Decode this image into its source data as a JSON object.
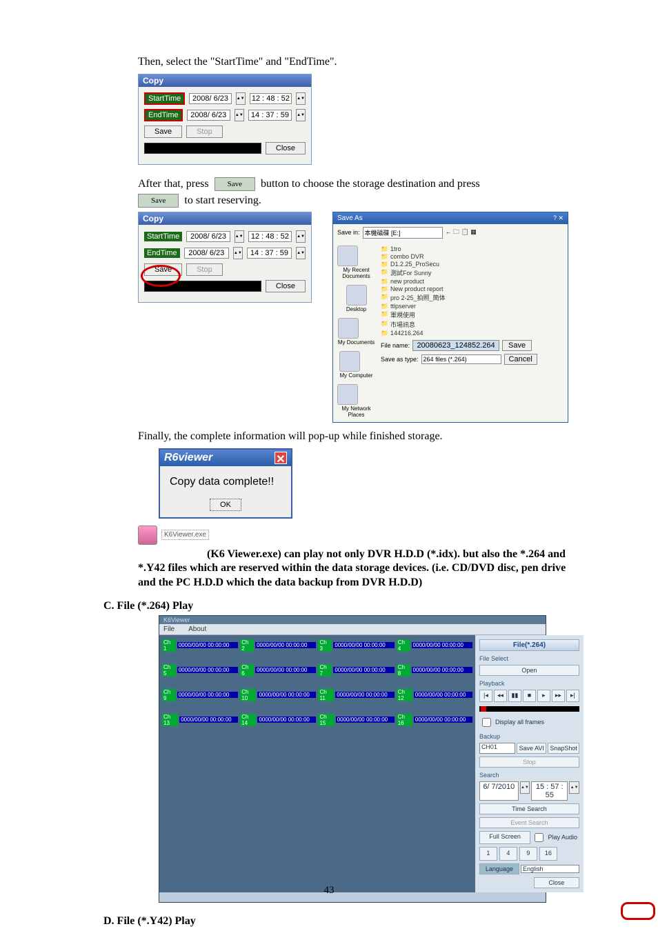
{
  "text": {
    "intro": "Then, select the \"StartTime\" and \"EndTime\".",
    "afterPress1": "After that, press ",
    "afterPress2": " button to choose the storage destination and press ",
    "startReserve": " to start reserving.",
    "finally": "Finally, the complete information will pop-up while finished storage.",
    "k6para": " (K6 Viewer.exe) can play not only DVR H.D.D (*.idx). but also the *.264 and *.Y42 files which are reserved within the data storage devices. (i.e. CD/DVD disc, pen drive and the PC H.D.D which the data backup from DVR H.D.D)",
    "headC": "C.  File (*.264) Play",
    "headD": "D.  File (*.Y42) Play",
    "pageNum": "43"
  },
  "copyDlg": {
    "title": "Copy",
    "startLabel": "StartTime",
    "endLabel": "EndTime",
    "date": "2008/ 6/23",
    "t1": "12 : 48 : 52",
    "t2": "14 : 37 : 59",
    "save": "Save",
    "stop": "Stop",
    "close": "Close"
  },
  "saveBtn": {
    "label": "Save"
  },
  "saveAs": {
    "title": "Save As",
    "saveIn": "Save in:",
    "saveInVal": "本機磁碟 [E:]",
    "places": [
      "My Recent Documents",
      "Desktop",
      "My Documents",
      "My Computer",
      "My Network Places"
    ],
    "folders": [
      "1tro",
      "combo DVR",
      "D1.2.25_ProSecu",
      "測試For Sunny",
      "new product",
      "New product report",
      "pro 2-25_拍照_簡体",
      "ttlpserver",
      "軍規使用",
      "市場訊息",
      "144216.264"
    ],
    "fnLbl": "File name:",
    "fnVal": "20080623_124852.264",
    "typeLbl": "Save as type:",
    "typeVal": "264 files (*.264)",
    "save": "Save",
    "cancel": "Cancel"
  },
  "msg": {
    "title": "R6viewer",
    "body": "Copy data complete!!",
    "ok": "OK"
  },
  "exe": {
    "label": "K6Viewer.exe"
  },
  "player": {
    "title": "K6Viewer",
    "menuFile": "File",
    "menuAbout": "About",
    "chTs": "0000/00/00  00:00:00",
    "ch": [
      "Ch 1",
      "Ch 2",
      "Ch 3",
      "Ch 4",
      "Ch 5",
      "Ch 6",
      "Ch 7",
      "Ch 8",
      "Ch 9",
      "Ch 10",
      "Ch 11",
      "Ch 12",
      "Ch 13",
      "Ch 14",
      "Ch 15",
      "Ch 16"
    ],
    "sideTitle": "File(*.264)",
    "fileSelect": "File Select",
    "open": "Open",
    "playback": "Playback",
    "dispAll": "Display all frames",
    "backup": "Backup",
    "backupCh": "CH01",
    "saveAvi": "Save AVI",
    "snap": "SnapShot",
    "stop": "Stop",
    "search": "Search",
    "searchDate": "6/ 7/2010",
    "searchTime": "15 : 57 : 55",
    "tsearch": "Time Search",
    "eventSearch": "Event Search",
    "fs": "Full Screen",
    "pa": "Play Audio",
    "g": [
      "1",
      "4",
      "9",
      "16"
    ],
    "lang": "Language",
    "langVal": "English",
    "close": "Close"
  }
}
